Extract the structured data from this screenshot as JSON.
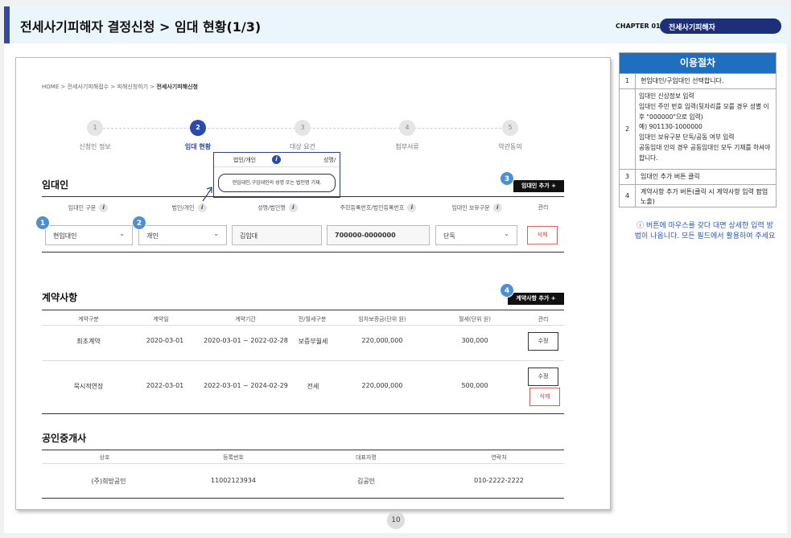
{
  "header": {
    "title": "전세사기피해자 결정신청 > 임대 현황(1/3)",
    "chapter": "CHAPTER 01",
    "chapter_name": "전세사기피해자"
  },
  "breadcrumb": {
    "home": "HOME",
    "sep": ">",
    "item1": "전세사기피해접수",
    "item2": "피해신청하기",
    "current": "전세사기피해신청"
  },
  "steps": [
    {
      "num": "1",
      "label": "신청인 정보"
    },
    {
      "num": "2",
      "label": "임대 현황"
    },
    {
      "num": "3",
      "label": "대상 요건"
    },
    {
      "num": "4",
      "label": "첨부서류"
    },
    {
      "num": "5",
      "label": "약관동의"
    }
  ],
  "tooltip": {
    "col1": "법인/개인",
    "col2": "성명/",
    "info": "i",
    "text": "현임대인,구임대인의 성명 또는 법인명 기재."
  },
  "landlord": {
    "title": "임대인",
    "add_button": "임대인 추가 +",
    "headers": [
      "임대인 구분",
      "법인/개인",
      "성명/법인명",
      "주민등록번호/법인등록번호",
      "임대인 보유구분",
      "관리"
    ],
    "type_value": "현임대인",
    "person_value": "개인",
    "name_value": "김임대",
    "id_value": "700000-0000000",
    "own_value": "단독",
    "delete_label": "삭제"
  },
  "contract": {
    "title": "계약사항",
    "add_button": "계약사항 추가 +",
    "headers": [
      "계약구분",
      "계약일",
      "계약기간",
      "전/월세구분",
      "임차보증금(단위 원)",
      "월세(단위 원)",
      "관리"
    ],
    "rows": [
      {
        "kind": "최초계약",
        "date": "2020-03-01",
        "period": "2020-03-01 ~ 2022-02-28",
        "type": "보증부월세",
        "deposit": "220,000,000",
        "rent": "300,000",
        "edit": "수정"
      },
      {
        "kind": "묵시적연장",
        "date": "2022-03-01",
        "period": "2022-03-01 ~ 2024-02-29",
        "type": "전세",
        "deposit": "220,000,000",
        "rent": "500,000",
        "edit": "수정",
        "delete": "삭제"
      }
    ]
  },
  "broker": {
    "title": "공인중개사",
    "headers": [
      "상호",
      "등록번호",
      "대표자명",
      "연락처"
    ],
    "row": {
      "name": "(주)희망공인",
      "reg": "11002123934",
      "rep": "김공인",
      "phone": "010-2222-2222"
    }
  },
  "badges": [
    "1",
    "2",
    "3",
    "4"
  ],
  "page_number": "10",
  "procedure": {
    "title": "이용절차",
    "items": [
      {
        "num": "1",
        "text": "현임대인/구임대인 선택합니다."
      },
      {
        "num": "2",
        "text": "임대인 신상정보 입력\n임대인 주민 번호 입력(뒷자리를 모를 경우 성별 이후 \"000000\"으로 입력)\n예) 901130-1000000\n임대인 보유구분 단독/공동 여부 입력\n공동임대 인의 경우 공동임대인 모두 기재를 하셔야 합니다."
      },
      {
        "num": "3",
        "text": "임대인 추가 버튼 클릭"
      },
      {
        "num": "4",
        "text": "계약사항 추가 버튼(클릭 시 계약사항 입력 팝업 노출)"
      }
    ]
  },
  "note": "ⓘ 버튼에 마우스를 갖다 대면 상세한 입력 방법이 나옵니다. 모든 필드에서 활용하여 주세요",
  "colors": {
    "primary": "#2c4aa8",
    "panel_head": "#1f6fc0",
    "badge": "#4e8fd1",
    "danger": "#d23c3c"
  }
}
